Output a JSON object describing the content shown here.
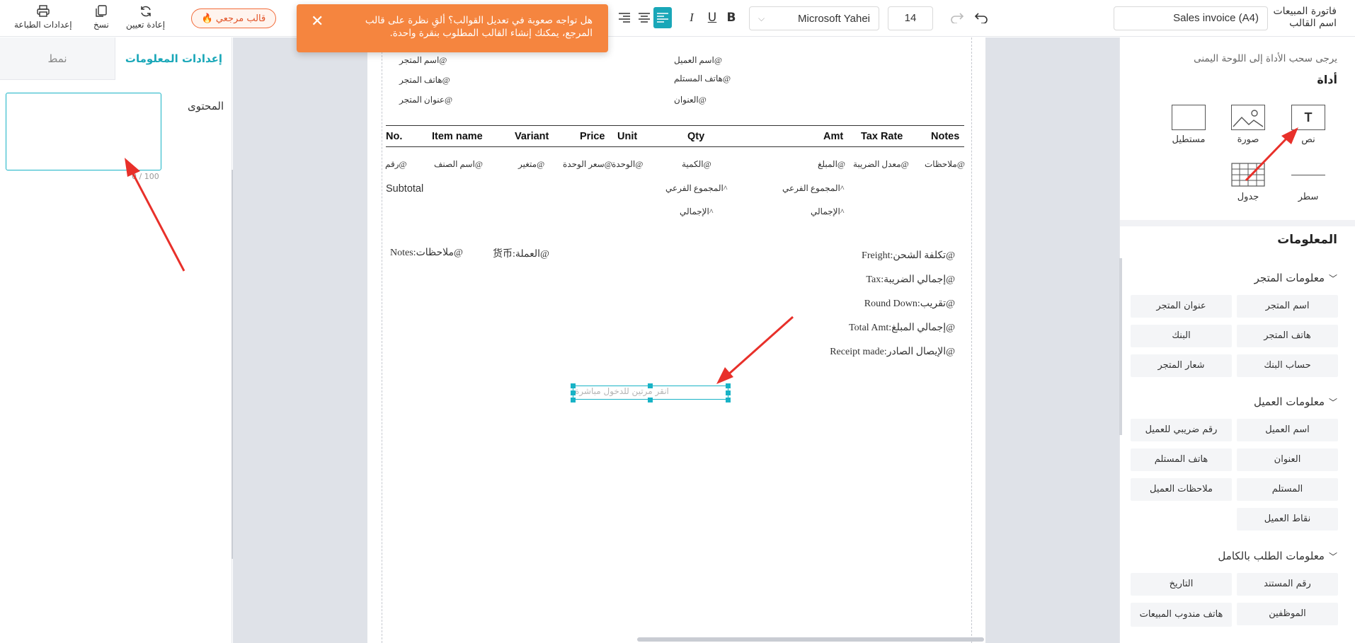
{
  "toolbar": {
    "print_settings": "إعدادات الطباعة",
    "copy": "نسخ",
    "reset": "إعادة تعيين",
    "reference_template": "قالب مرجعي",
    "font_family": "Microsoft Yahei",
    "font_size": "14",
    "template_name_value": "Sales invoice (A4)",
    "template_name_label": "اسم القالب",
    "template_type": "فاتورة المبيعات",
    "bold": "B",
    "underline": "U",
    "italic": "I"
  },
  "toast": {
    "message": "هل تواجه صعوبة في تعديل القوالب؟ ألقِ نظرة على قالب المرجع، يمكنك إنشاء القالب المطلوب بنقرة واحدة."
  },
  "left_panel": {
    "tab_style": "نمط",
    "tab_info_settings": "إعدادات المعلومات",
    "content_label": "المحتوى",
    "counter": "0 / 100"
  },
  "invoice": {
    "header_left": [
      "اسم المتجر@",
      "هاتف المتجر@",
      "عنوان المتجر@"
    ],
    "header_right": [
      "اسم العميل@",
      "هاتف المستلم@",
      "العنوان@"
    ],
    "columns": [
      "No.",
      "Item name",
      "Variant",
      "Price",
      "Unit",
      "Qty",
      "Amt",
      "Tax Rate",
      "Notes"
    ],
    "row_fields": [
      "رقم@",
      "اسم الصنف@",
      "متغير@",
      "سعر الوحدة@",
      "الوحدة@",
      "الكمية@",
      "المبلغ@",
      "معدل الضريبة@",
      "ملاحظات@"
    ],
    "subtotal_label": "Subtotal",
    "subtotal_qty": "المجموع الفرعي^",
    "subtotal_amt": "المجموع الفرعي^",
    "total_qty": "الإجمالي^",
    "total_amt": "الإجمالي^",
    "notes_field": "Notes:ملاحظات@",
    "currency_field": "货币:العملة@",
    "summary": [
      "Freight:تكلفة الشحن@",
      "Tax:إجمالي الضريبة@",
      "Round Down:تقريب@",
      "Total Amt:إجمالي المبلغ@",
      "Receipt made:الإيصال الصادر@"
    ],
    "selected_placeholder": "انقر مرتين للدخول مباشرة"
  },
  "right_panel": {
    "hint": "يرجى سحب الأداة إلى اللوحة اليمنى",
    "tools_title": "أداة",
    "tools": [
      "نص",
      "صورة",
      "مستطيل",
      "سطر",
      "جدول"
    ],
    "info_title": "المعلومات",
    "groups": [
      {
        "title": "معلومات المتجر",
        "items": [
          "اسم المتجر",
          "عنوان المتجر",
          "هاتف المتجر",
          "البنك",
          "حساب البنك",
          "شعار المتجر"
        ]
      },
      {
        "title": "معلومات العميل",
        "items": [
          "اسم العميل",
          "رقم ضريبي للعميل",
          "العنوان",
          "هاتف المستلم",
          "المستلم",
          "ملاحظات العميل",
          "نقاط العميل"
        ]
      },
      {
        "title": "معلومات الطلب بالكامل",
        "items": [
          "رقم المستند",
          "التاريخ",
          "الموظفين",
          "هاتف مندوب المبيعات"
        ]
      }
    ]
  },
  "colors": {
    "accent": "#19a7b8",
    "toast": "#f5853f",
    "arrow": "#e8302a",
    "hot": "#f26b3a"
  }
}
